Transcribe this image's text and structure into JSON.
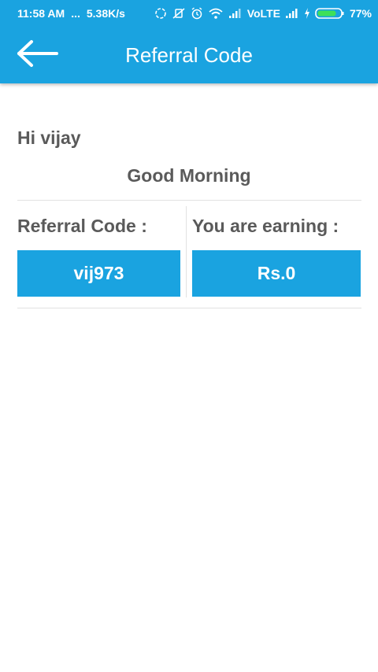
{
  "status_bar": {
    "time": "11:58 AM",
    "dots": "...",
    "speed": "5.38K/s",
    "network": "VoLTE",
    "battery": "77%"
  },
  "header": {
    "title": "Referral Code",
    "back_icon": "arrow-left-icon"
  },
  "greeting": {
    "name_line": "Hi vijay",
    "time_line": "Good Morning"
  },
  "referral": {
    "code_label": "Referral Code :",
    "code_value": "vij973",
    "earning_label": "You are earning :",
    "earning_value": "Rs.0"
  },
  "colors": {
    "primary": "#1aa3e0",
    "text": "#5a5a5a",
    "divider": "#e2e2e2"
  }
}
